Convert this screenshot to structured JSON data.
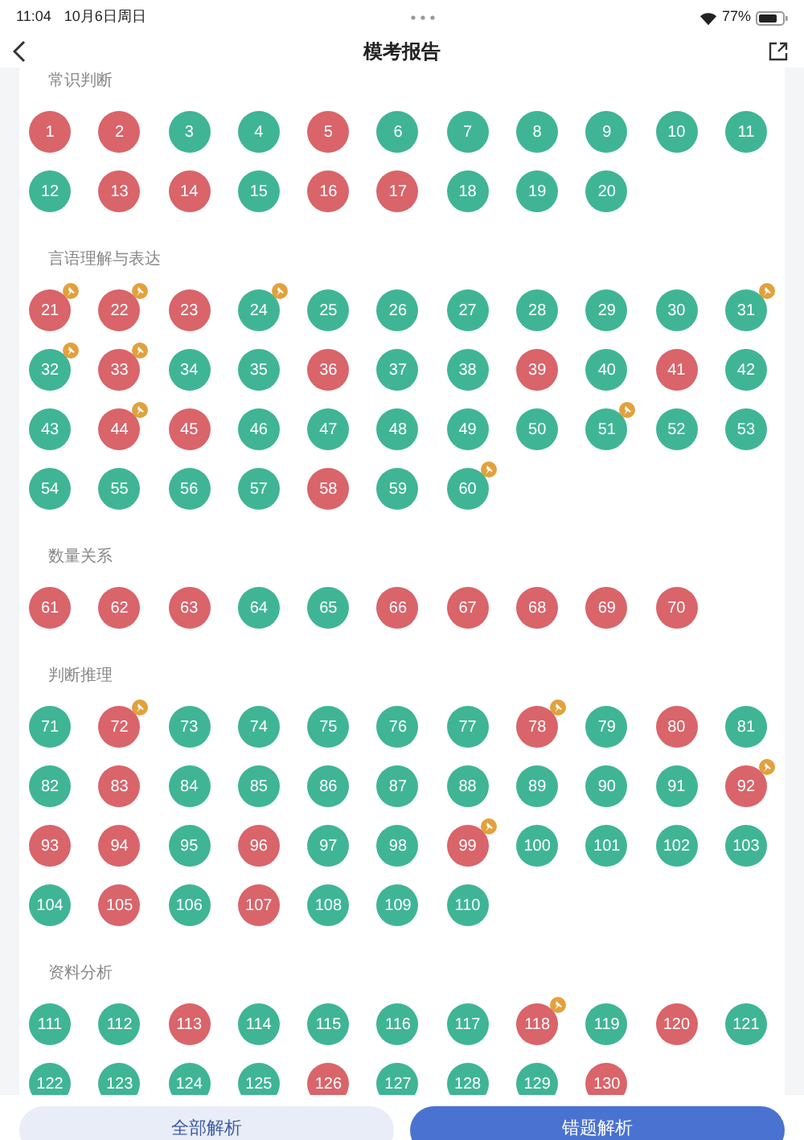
{
  "status_bar": {
    "time": "11:04",
    "date": "10月6日周日",
    "battery": "77%"
  },
  "header": {
    "title": "模考报告"
  },
  "sections": [
    {
      "title": "常识判断",
      "questions": [
        {
          "number": "1",
          "correct": false,
          "pinned": false
        },
        {
          "number": "2",
          "correct": false,
          "pinned": false
        },
        {
          "number": "3",
          "correct": true,
          "pinned": false
        },
        {
          "number": "4",
          "correct": true,
          "pinned": false
        },
        {
          "number": "5",
          "correct": false,
          "pinned": false
        },
        {
          "number": "6",
          "correct": true,
          "pinned": false
        },
        {
          "number": "7",
          "correct": true,
          "pinned": false
        },
        {
          "number": "8",
          "correct": true,
          "pinned": false
        },
        {
          "number": "9",
          "correct": true,
          "pinned": false
        },
        {
          "number": "10",
          "correct": true,
          "pinned": false
        },
        {
          "number": "11",
          "correct": true,
          "pinned": false
        },
        {
          "number": "12",
          "correct": true,
          "pinned": false
        },
        {
          "number": "13",
          "correct": false,
          "pinned": false
        },
        {
          "number": "14",
          "correct": false,
          "pinned": false
        },
        {
          "number": "15",
          "correct": true,
          "pinned": false
        },
        {
          "number": "16",
          "correct": false,
          "pinned": false
        },
        {
          "number": "17",
          "correct": false,
          "pinned": false
        },
        {
          "number": "18",
          "correct": true,
          "pinned": false
        },
        {
          "number": "19",
          "correct": true,
          "pinned": false
        },
        {
          "number": "20",
          "correct": true,
          "pinned": false
        }
      ]
    },
    {
      "title": "言语理解与表达",
      "questions": [
        {
          "number": "21",
          "correct": false,
          "pinned": true
        },
        {
          "number": "22",
          "correct": false,
          "pinned": true
        },
        {
          "number": "23",
          "correct": false,
          "pinned": false
        },
        {
          "number": "24",
          "correct": true,
          "pinned": true
        },
        {
          "number": "25",
          "correct": true,
          "pinned": false
        },
        {
          "number": "26",
          "correct": true,
          "pinned": false
        },
        {
          "number": "27",
          "correct": true,
          "pinned": false
        },
        {
          "number": "28",
          "correct": true,
          "pinned": false
        },
        {
          "number": "29",
          "correct": true,
          "pinned": false
        },
        {
          "number": "30",
          "correct": true,
          "pinned": false
        },
        {
          "number": "31",
          "correct": true,
          "pinned": true
        },
        {
          "number": "32",
          "correct": true,
          "pinned": true
        },
        {
          "number": "33",
          "correct": false,
          "pinned": true
        },
        {
          "number": "34",
          "correct": true,
          "pinned": false
        },
        {
          "number": "35",
          "correct": true,
          "pinned": false
        },
        {
          "number": "36",
          "correct": false,
          "pinned": false
        },
        {
          "number": "37",
          "correct": true,
          "pinned": false
        },
        {
          "number": "38",
          "correct": true,
          "pinned": false
        },
        {
          "number": "39",
          "correct": false,
          "pinned": false
        },
        {
          "number": "40",
          "correct": true,
          "pinned": false
        },
        {
          "number": "41",
          "correct": false,
          "pinned": false
        },
        {
          "number": "42",
          "correct": true,
          "pinned": false
        },
        {
          "number": "43",
          "correct": true,
          "pinned": false
        },
        {
          "number": "44",
          "correct": false,
          "pinned": true
        },
        {
          "number": "45",
          "correct": false,
          "pinned": false
        },
        {
          "number": "46",
          "correct": true,
          "pinned": false
        },
        {
          "number": "47",
          "correct": true,
          "pinned": false
        },
        {
          "number": "48",
          "correct": true,
          "pinned": false
        },
        {
          "number": "49",
          "correct": true,
          "pinned": false
        },
        {
          "number": "50",
          "correct": true,
          "pinned": false
        },
        {
          "number": "51",
          "correct": true,
          "pinned": true
        },
        {
          "number": "52",
          "correct": true,
          "pinned": false
        },
        {
          "number": "53",
          "correct": true,
          "pinned": false
        },
        {
          "number": "54",
          "correct": true,
          "pinned": false
        },
        {
          "number": "55",
          "correct": true,
          "pinned": false
        },
        {
          "number": "56",
          "correct": true,
          "pinned": false
        },
        {
          "number": "57",
          "correct": true,
          "pinned": false
        },
        {
          "number": "58",
          "correct": false,
          "pinned": false
        },
        {
          "number": "59",
          "correct": true,
          "pinned": false
        },
        {
          "number": "60",
          "correct": true,
          "pinned": true
        }
      ]
    },
    {
      "title": "数量关系",
      "questions": [
        {
          "number": "61",
          "correct": false,
          "pinned": false
        },
        {
          "number": "62",
          "correct": false,
          "pinned": false
        },
        {
          "number": "63",
          "correct": false,
          "pinned": false
        },
        {
          "number": "64",
          "correct": true,
          "pinned": false
        },
        {
          "number": "65",
          "correct": true,
          "pinned": false
        },
        {
          "number": "66",
          "correct": false,
          "pinned": false
        },
        {
          "number": "67",
          "correct": false,
          "pinned": false
        },
        {
          "number": "68",
          "correct": false,
          "pinned": false
        },
        {
          "number": "69",
          "correct": false,
          "pinned": false
        },
        {
          "number": "70",
          "correct": false,
          "pinned": false
        }
      ]
    },
    {
      "title": "判断推理",
      "questions": [
        {
          "number": "71",
          "correct": true,
          "pinned": false
        },
        {
          "number": "72",
          "correct": false,
          "pinned": true
        },
        {
          "number": "73",
          "correct": true,
          "pinned": false
        },
        {
          "number": "74",
          "correct": true,
          "pinned": false
        },
        {
          "number": "75",
          "correct": true,
          "pinned": false
        },
        {
          "number": "76",
          "correct": true,
          "pinned": false
        },
        {
          "number": "77",
          "correct": true,
          "pinned": false
        },
        {
          "number": "78",
          "correct": false,
          "pinned": true
        },
        {
          "number": "79",
          "correct": true,
          "pinned": false
        },
        {
          "number": "80",
          "correct": false,
          "pinned": false
        },
        {
          "number": "81",
          "correct": true,
          "pinned": false
        },
        {
          "number": "82",
          "correct": true,
          "pinned": false
        },
        {
          "number": "83",
          "correct": false,
          "pinned": false
        },
        {
          "number": "84",
          "correct": true,
          "pinned": false
        },
        {
          "number": "85",
          "correct": true,
          "pinned": false
        },
        {
          "number": "86",
          "correct": true,
          "pinned": false
        },
        {
          "number": "87",
          "correct": true,
          "pinned": false
        },
        {
          "number": "88",
          "correct": true,
          "pinned": false
        },
        {
          "number": "89",
          "correct": true,
          "pinned": false
        },
        {
          "number": "90",
          "correct": true,
          "pinned": false
        },
        {
          "number": "91",
          "correct": true,
          "pinned": false
        },
        {
          "number": "92",
          "correct": false,
          "pinned": true
        },
        {
          "number": "93",
          "correct": false,
          "pinned": false
        },
        {
          "number": "94",
          "correct": false,
          "pinned": false
        },
        {
          "number": "95",
          "correct": true,
          "pinned": false
        },
        {
          "number": "96",
          "correct": false,
          "pinned": false
        },
        {
          "number": "97",
          "correct": true,
          "pinned": false
        },
        {
          "number": "98",
          "correct": true,
          "pinned": false
        },
        {
          "number": "99",
          "correct": false,
          "pinned": true
        },
        {
          "number": "100",
          "correct": true,
          "pinned": false
        },
        {
          "number": "101",
          "correct": true,
          "pinned": false
        },
        {
          "number": "102",
          "correct": true,
          "pinned": false
        },
        {
          "number": "103",
          "correct": true,
          "pinned": false
        },
        {
          "number": "104",
          "correct": true,
          "pinned": false
        },
        {
          "number": "105",
          "correct": false,
          "pinned": false
        },
        {
          "number": "106",
          "correct": true,
          "pinned": false
        },
        {
          "number": "107",
          "correct": false,
          "pinned": false
        },
        {
          "number": "108",
          "correct": true,
          "pinned": false
        },
        {
          "number": "109",
          "correct": true,
          "pinned": false
        },
        {
          "number": "110",
          "correct": true,
          "pinned": false
        }
      ]
    },
    {
      "title": "资料分析",
      "questions": [
        {
          "number": "111",
          "correct": true,
          "pinned": false
        },
        {
          "number": "112",
          "correct": true,
          "pinned": false
        },
        {
          "number": "113",
          "correct": false,
          "pinned": false
        },
        {
          "number": "114",
          "correct": true,
          "pinned": false
        },
        {
          "number": "115",
          "correct": true,
          "pinned": false
        },
        {
          "number": "116",
          "correct": true,
          "pinned": false
        },
        {
          "number": "117",
          "correct": true,
          "pinned": false
        },
        {
          "number": "118",
          "correct": false,
          "pinned": true
        },
        {
          "number": "119",
          "correct": true,
          "pinned": false
        },
        {
          "number": "120",
          "correct": false,
          "pinned": false
        },
        {
          "number": "121",
          "correct": true,
          "pinned": false
        },
        {
          "number": "122",
          "correct": true,
          "pinned": false
        },
        {
          "number": "123",
          "correct": true,
          "pinned": false
        },
        {
          "number": "124",
          "correct": true,
          "pinned": false
        },
        {
          "number": "125",
          "correct": true,
          "pinned": false
        },
        {
          "number": "126",
          "correct": false,
          "pinned": false
        },
        {
          "number": "127",
          "correct": true,
          "pinned": false
        },
        {
          "number": "128",
          "correct": true,
          "pinned": false
        },
        {
          "number": "129",
          "correct": true,
          "pinned": false
        },
        {
          "number": "130",
          "correct": false,
          "pinned": false
        }
      ]
    }
  ],
  "buttons": [
    {
      "label": "全部解析",
      "selected": false
    },
    {
      "label": "错题解析",
      "selected": true
    }
  ]
}
